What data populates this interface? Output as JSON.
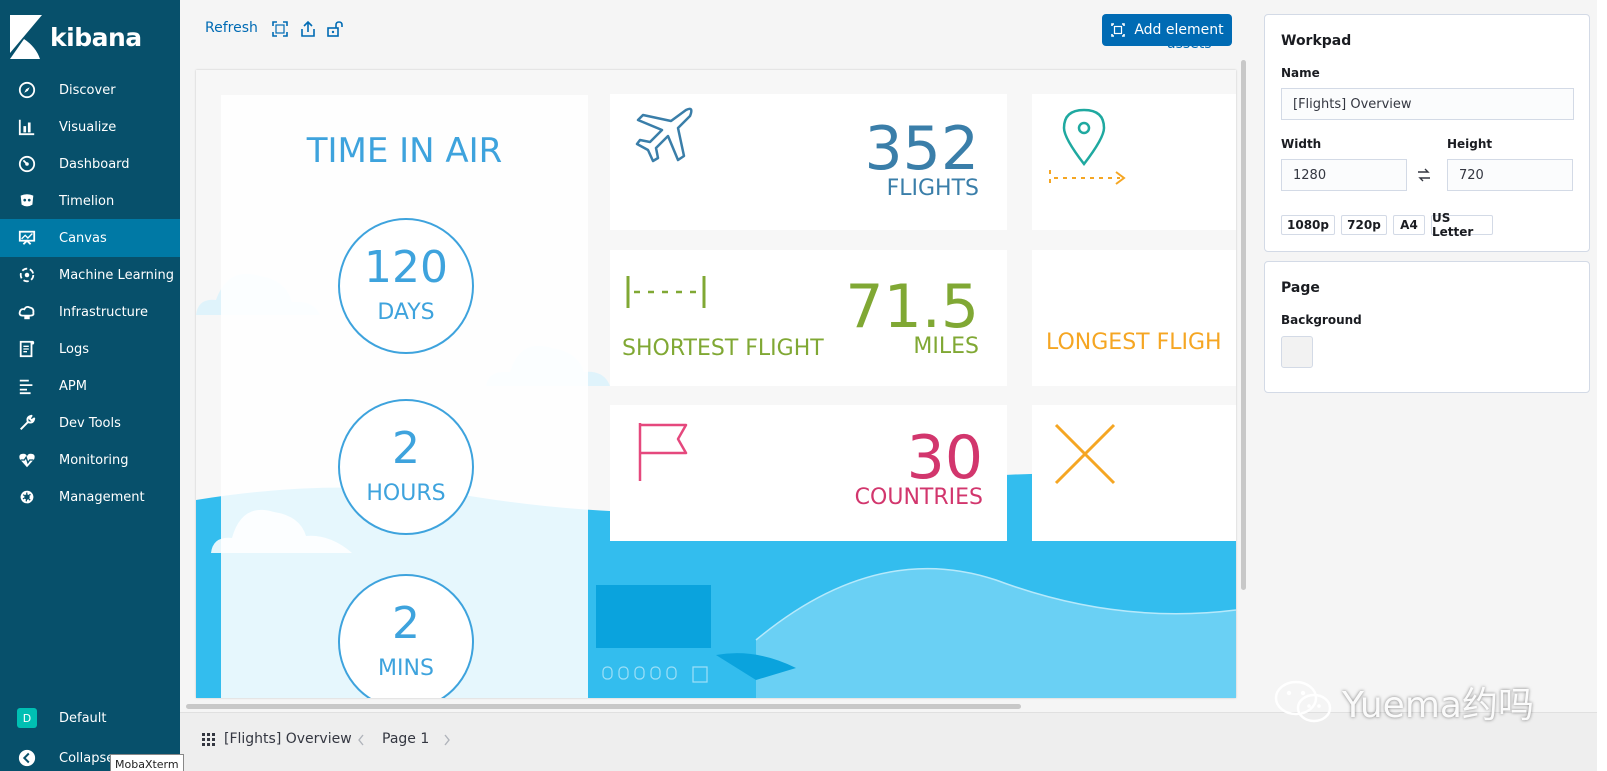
{
  "sidebar": {
    "brand": "kibana",
    "items": [
      {
        "label": "Discover",
        "icon": "compass-icon"
      },
      {
        "label": "Visualize",
        "icon": "bar-chart-icon"
      },
      {
        "label": "Dashboard",
        "icon": "gauge-icon"
      },
      {
        "label": "Timelion",
        "icon": "timelion-icon"
      },
      {
        "label": "Canvas",
        "icon": "canvas-icon",
        "active": true
      },
      {
        "label": "Machine Learning",
        "icon": "ml-icon"
      },
      {
        "label": "Infrastructure",
        "icon": "infrastructure-icon"
      },
      {
        "label": "Logs",
        "icon": "logs-icon"
      },
      {
        "label": "APM",
        "icon": "apm-icon"
      },
      {
        "label": "Dev Tools",
        "icon": "wrench-icon"
      },
      {
        "label": "Monitoring",
        "icon": "heartbeat-icon"
      },
      {
        "label": "Management",
        "icon": "gear-icon"
      }
    ],
    "space_badge": "D",
    "space_label": "Default",
    "collapse_label": "Collapse"
  },
  "toolbar": {
    "refresh_label": "Refresh",
    "manage_assets_label": "Manage assets",
    "add_element_label": "Add element"
  },
  "workpad": {
    "time_in_air_title": "TIME IN AIR",
    "time_blocks": [
      {
        "value": "120",
        "unit": "DAYS"
      },
      {
        "value": "2",
        "unit": "HOURS"
      },
      {
        "value": "2",
        "unit": "MINS"
      }
    ],
    "flights_value": "352",
    "flights_label": "FLIGHTS",
    "shortest_label": "SHORTEST FLIGHT",
    "shortest_value": "71.5",
    "shortest_unit": "MILES",
    "longest_label": "LONGEST FLIGH",
    "countries_value": "30",
    "countries_label": "COUNTRIES",
    "colors": {
      "flights": "#3a7ea9",
      "shortest": "#80a834",
      "longest": "#f5a623",
      "countries": "#d2366d",
      "sky": "#33bdee",
      "circle": "#3ea3dd"
    }
  },
  "panel": {
    "workpad_title": "Workpad",
    "name_label": "Name",
    "name_value": "[Flights] Overview",
    "width_label": "Width",
    "width_value": "1280",
    "height_label": "Height",
    "height_value": "720",
    "presets": [
      "1080p",
      "720p",
      "A4",
      "US Letter"
    ],
    "page_title": "Page",
    "background_label": "Background"
  },
  "footer": {
    "workpad_name": "[Flights] Overview",
    "page_label": "Page 1"
  },
  "tooltip": "MobaXterm",
  "watermark": "Yuema约吗"
}
